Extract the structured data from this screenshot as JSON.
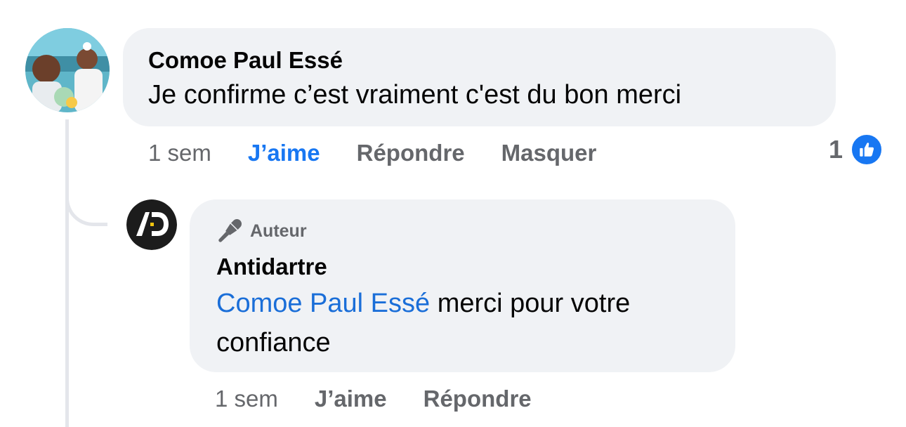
{
  "comment": {
    "author": "Comoe Paul Essé",
    "text": "Je confirme c’est vraiment c'est du bon merci",
    "actions": {
      "time": "1 sem",
      "like": "J’aime",
      "reply": "Répondre",
      "hide": "Masquer"
    },
    "reactions": {
      "count": "1",
      "icon": "like-icon"
    }
  },
  "reply": {
    "badge": "Auteur",
    "author": "Antidartre",
    "mention": "Comoe Paul Essé",
    "text": " merci pour votre confiance",
    "actions": {
      "time": "1 sem",
      "like": "J’aime",
      "reply": "Répondre"
    }
  },
  "colors": {
    "bubble": "#f0f2f5",
    "link": "#1a6ed8",
    "like_active": "#1877f2",
    "muted": "#65676b"
  }
}
